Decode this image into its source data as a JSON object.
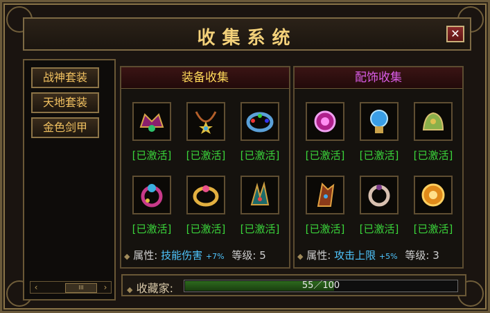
{
  "window": {
    "title": "收集系统",
    "close_icon": "close-icon"
  },
  "sidebar": {
    "items": [
      {
        "label": "战神套装"
      },
      {
        "label": "天地套装"
      },
      {
        "label": "金色剑甲"
      }
    ]
  },
  "equipment": {
    "title": "装备收集",
    "title_color": "#ffd95a",
    "items": [
      {
        "name": "wing-crown-icon",
        "state": "[已激活]"
      },
      {
        "name": "star-necklace-icon",
        "state": "[已激活]"
      },
      {
        "name": "jeweled-bracelet-icon",
        "state": "[已激活]"
      },
      {
        "name": "gem-ring-icon",
        "state": "[已激活]"
      },
      {
        "name": "gold-ring-icon",
        "state": "[已激活]"
      },
      {
        "name": "dragon-claw-icon",
        "state": "[已激活]"
      }
    ],
    "attr_label": "属性:",
    "attr_value": "技能伤害",
    "attr_bonus": "+7%",
    "level_label": "等级:",
    "level_value": "5"
  },
  "accessory": {
    "title": "配饰收集",
    "title_color": "#d95ce6",
    "items": [
      {
        "name": "purple-orb-icon",
        "state": "[已激活]"
      },
      {
        "name": "blue-crystal-icon",
        "state": "[已激活]"
      },
      {
        "name": "jade-beast-icon",
        "state": "[已激活]"
      },
      {
        "name": "flame-tome-icon",
        "state": "[已激活]"
      },
      {
        "name": "bone-ring-icon",
        "state": "[已激活]"
      },
      {
        "name": "golden-emblem-icon",
        "state": "[已激活]"
      }
    ],
    "attr_label": "属性:",
    "attr_value": "攻击上限",
    "attr_bonus": "+5%",
    "level_label": "等级:",
    "level_value": "3"
  },
  "collector": {
    "label": "收藏家:",
    "progress_text": "55／100",
    "progress": 0.55
  }
}
